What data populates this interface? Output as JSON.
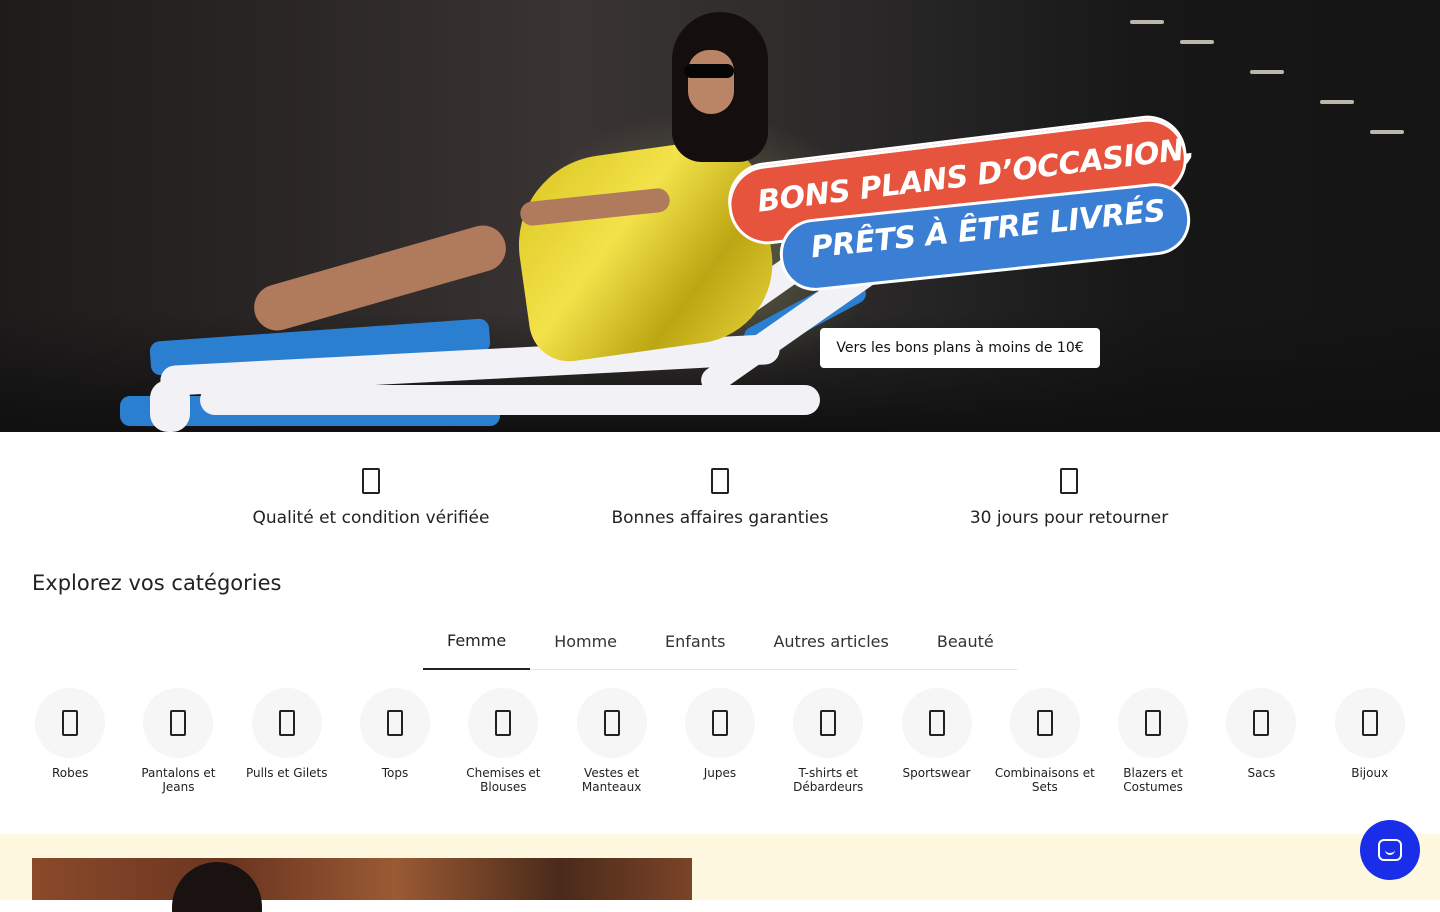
{
  "hero": {
    "promo_line1": "BONS PLANS D’OCCASION,",
    "promo_line2": "PRÊTS À ÊTRE LIVRÉS",
    "cta_label": "Vers les bons plans à moins de 10€",
    "colors": {
      "promo_red": "#e6543e",
      "promo_blue": "#3b7fd4",
      "dress": "#e6d53a",
      "cushion": "#2a7fd0"
    }
  },
  "features": [
    {
      "icon": "quality-check-icon",
      "label": "Qualité et condition vérifiée"
    },
    {
      "icon": "deal-tag-icon",
      "label": "Bonnes affaires garanties"
    },
    {
      "icon": "return-box-icon",
      "label": "30 jours pour retourner"
    }
  ],
  "categories": {
    "title": "Explorez vos catégories",
    "tabs": [
      {
        "label": "Femme",
        "active": true
      },
      {
        "label": "Homme",
        "active": false
      },
      {
        "label": "Enfants",
        "active": false
      },
      {
        "label": "Autres articles",
        "active": false
      },
      {
        "label": "Beauté",
        "active": false
      }
    ],
    "items": [
      {
        "icon": "dress-icon",
        "label": "Robes"
      },
      {
        "icon": "pants-icon",
        "label": "Pantalons et Jeans"
      },
      {
        "icon": "sweater-icon",
        "label": "Pulls et Gilets"
      },
      {
        "icon": "top-icon",
        "label": "Tops"
      },
      {
        "icon": "shirt-icon",
        "label": "Chemises et Blouses"
      },
      {
        "icon": "coat-icon",
        "label": "Vestes et Manteaux"
      },
      {
        "icon": "skirt-icon",
        "label": "Jupes"
      },
      {
        "icon": "tshirt-icon",
        "label": "T-shirts et Débardeurs"
      },
      {
        "icon": "sportswear-icon",
        "label": "Sportswear"
      },
      {
        "icon": "jumpsuit-icon",
        "label": "Combinaisons et Sets"
      },
      {
        "icon": "blazer-icon",
        "label": "Blazers et Costumes"
      },
      {
        "icon": "bag-icon",
        "label": "Sacs"
      },
      {
        "icon": "jewelry-icon",
        "label": "Bijoux"
      }
    ]
  },
  "chat": {
    "icon": "chat-icon",
    "color": "#1a2de8"
  },
  "bottom": {
    "background": "#fff8e0"
  }
}
